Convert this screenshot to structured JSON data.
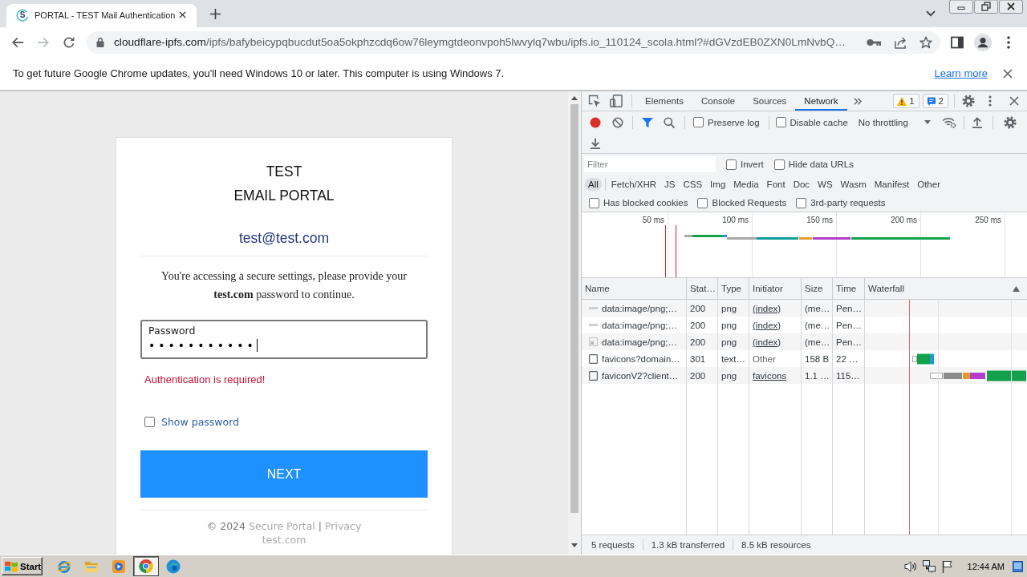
{
  "browser": {
    "tabs": [
      {
        "favicon": "S",
        "title": "PORTAL - TEST Mail Authentication",
        "selected": true
      }
    ],
    "forward": {
      "disabled": true
    },
    "url": {
      "host": "cloudflare-ipfs.com",
      "path": "/ipfs/bafybeicypqbucdut5oa5okphzcdq6ow76leymgtdeonvpoh5lwvylq7wbu/ipfs.io_110124_scola.html?#dGVzdEB0ZXN0LmNvbQ…"
    },
    "infobar": {
      "message": "To get future Google Chrome updates, you'll need Windows 10 or later. This computer is using Windows 7.",
      "link": "Learn more"
    }
  },
  "page": {
    "title": [
      "TEST",
      "EMAIL PORTAL"
    ],
    "email": "test@test.com",
    "message": "You're accessing a secure settings, please provide your **test.com** password to continue.",
    "password": {
      "label": "Password",
      "value": "•••••••••••",
      "focused": true
    },
    "error": "Authentication is required!",
    "show_password": {
      "label": "Show password",
      "checked": false
    },
    "button": "NEXT",
    "footer": {
      "copyright": "© 2024",
      "links": [
        "Secure Portal",
        "Privacy"
      ],
      "separator": "|",
      "domain": "test.com"
    }
  },
  "devtools": {
    "tabs": [
      {
        "label": "Elements",
        "selected": false
      },
      {
        "label": "Console",
        "selected": false
      },
      {
        "label": "Sources",
        "selected": false
      },
      {
        "label": "Network",
        "selected": true
      }
    ],
    "issues": {
      "warnings": "1",
      "messages": "2"
    },
    "toolbar": {
      "preserve_log": {
        "label": "Preserve log",
        "checked": false
      },
      "disable_cache": {
        "label": "Disable cache",
        "checked": false
      },
      "throttling": "No throttling"
    },
    "filter": {
      "placeholder": "Filter",
      "options": [
        {
          "label": "Invert",
          "checked": false
        },
        {
          "label": "Hide data URLs",
          "checked": false
        }
      ]
    },
    "types": [
      {
        "label": "All",
        "selected": true
      },
      {
        "label": "Fetch/XHR",
        "selected": false
      },
      {
        "label": "JS",
        "selected": false
      },
      {
        "label": "CSS",
        "selected": false
      },
      {
        "label": "Img",
        "selected": false
      },
      {
        "label": "Media",
        "selected": false
      },
      {
        "label": "Font",
        "selected": false
      },
      {
        "label": "Doc",
        "selected": false
      },
      {
        "label": "WS",
        "selected": false
      },
      {
        "label": "Wasm",
        "selected": false
      },
      {
        "label": "Manifest",
        "selected": false
      },
      {
        "label": "Other",
        "selected": false
      }
    ],
    "request_options": [
      {
        "label": "Has blocked cookies",
        "checked": false
      },
      {
        "label": "Blocked Requests",
        "checked": false
      },
      {
        "label": "3rd-party requests",
        "checked": false
      }
    ],
    "overview": {
      "ticks": [
        "50 ms",
        "100 ms",
        "150 ms",
        "200 ms",
        "250 ms"
      ]
    },
    "table": {
      "columns": [
        "Name",
        "Stat…",
        "Type",
        "Initiator",
        "Size",
        "Time",
        "Waterfall"
      ],
      "rows": [
        {
          "kind": "thumbnail",
          "name": "data:image/png;…",
          "status": "200",
          "type": "png",
          "initiator": {
            "text": "(index)",
            "link": true
          },
          "size": "(me…",
          "time": "Pen…"
        },
        {
          "kind": "thumbnail",
          "name": "data:image/png;…",
          "status": "200",
          "type": "png",
          "initiator": {
            "text": "(index)",
            "link": true
          },
          "size": "(me…",
          "time": "Pen…"
        },
        {
          "kind": "image",
          "name": "data:image/png;…",
          "status": "200",
          "type": "png",
          "initiator": {
            "text": "(index)",
            "link": true
          },
          "size": "(me…",
          "time": "Pen…"
        },
        {
          "kind": "document",
          "name": "favicons?domain…",
          "status": "301",
          "type": "text…",
          "initiator": {
            "text": "Other",
            "link": false
          },
          "size": "158 B",
          "time": "22 …"
        },
        {
          "kind": "document",
          "name": "faviconV2?client…",
          "status": "200",
          "type": "png",
          "initiator": {
            "text": "favicons",
            "link": true
          },
          "size": "1.1 …",
          "time": "115…"
        }
      ]
    },
    "status": [
      "5 requests",
      "1.3 kB transferred",
      "8.5 kB resources"
    ]
  },
  "taskbar": {
    "start": "Start",
    "apps": [
      {
        "kind": "ie",
        "selected": false
      },
      {
        "kind": "folder",
        "selected": false
      },
      {
        "kind": "player",
        "selected": false
      },
      {
        "kind": "chrome",
        "selected": true
      },
      {
        "kind": "edge",
        "selected": false
      }
    ],
    "clock": "12:44 AM"
  }
}
